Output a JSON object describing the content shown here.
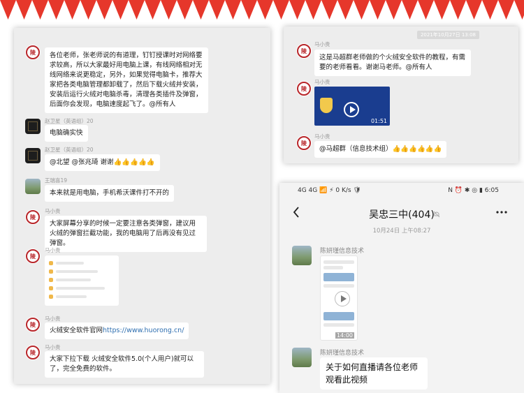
{
  "colors": {
    "banner_red": "#e6372b",
    "seal_red": "#b8262a",
    "link_blue": "#2f6fb0",
    "panel_bg": "#ededed"
  },
  "left_chat": {
    "messages": [
      {
        "sender": "马小贵",
        "avatar": "seal-icon",
        "text": "各位老师，张老师说的有道理，钉钉授课时对网络要求较高，所以大家最好用电脑上课，有线网络相对无线网络来说更稳定，另外，如果觉得电脑卡，推荐大家把各类电脑管理都卸载了，然后下载火绒并安装，安装后运行火绒对电脑杀毒，清理各类插件及弹窗，后面你会发现，电脑速度起飞了。@所有人"
      },
      {
        "sender": "赵卫星（英语组）20",
        "avatar": "dark-avatar",
        "text": "电脑确实快"
      },
      {
        "sender": "赵卫星（英语组）20",
        "avatar": "dark-avatar",
        "text": "@北望 @张兆琦 谢谢👍👍👍👍👍"
      },
      {
        "sender": "王瑞喜19",
        "avatar": "photo-avatar",
        "text": "本来就是用电脑，手机希沃课件打不开的"
      },
      {
        "sender": "马小贵",
        "avatar": "seal-icon",
        "text": "大家屏幕分享的时候一定要注意各类弹窗，建议用火绒的弹窗拦截功能，我的电脑用了后再没有见过弹窗。"
      },
      {
        "sender": "马小贵",
        "avatar": "seal-icon",
        "text": ""
      },
      {
        "sender": "马小贵",
        "avatar": "seal-icon",
        "text_prefix": "火绒安全软件官网",
        "link": "https://www.huorong.cn/"
      },
      {
        "sender": "马小贵",
        "avatar": "seal-icon",
        "text": "大家下拉下载 火绒安全软件5.0(个人用户)就可以了，完全免费的软件。"
      }
    ]
  },
  "top_right_chat": {
    "timestamp": "2021年10月27日 13:08",
    "messages": [
      {
        "sender": "马小贵",
        "text": "这是马超群老师做的个火绒安全软件的教程，有需要的老师看看。谢谢马老师。@所有人"
      },
      {
        "sender": "马小贵",
        "video_duration": "01:51"
      },
      {
        "sender": "马小贵",
        "text": "@马超群（信息技术组）👍👍👍👍👍👍"
      }
    ]
  },
  "phone": {
    "status_left": "4G 4G 📶 ⚡ 0 K/s 🛡",
    "status_right": "N ⏰ ✱ ◎ ▮ 6:05",
    "title": "吴忠三中(404)",
    "date": "10月24日 上午08:27",
    "messages": [
      {
        "sender": "陈妍瑾信息技术",
        "video_duration": "14:00"
      },
      {
        "sender": "陈妍瑾信息技术",
        "text": "关于如何直播请各位老师观看此视频"
      }
    ]
  }
}
